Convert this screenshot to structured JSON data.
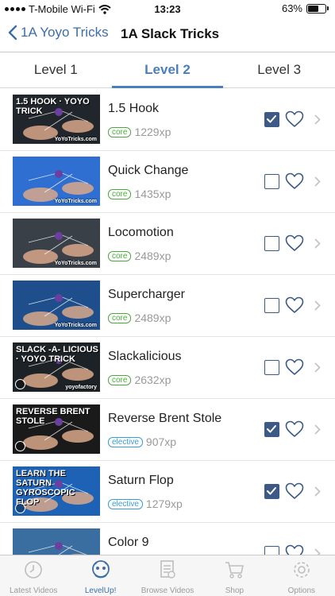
{
  "status_bar": {
    "carrier": "T-Mobile Wi-Fi",
    "time": "13:23",
    "battery": "63%",
    "battery_level": 0.63
  },
  "nav": {
    "back_label": "1A Yoyo Tricks",
    "title": "1A Slack Tricks"
  },
  "tabs": [
    {
      "label": "Level 1",
      "active": false
    },
    {
      "label": "Level 2",
      "active": true
    },
    {
      "label": "Level 3",
      "active": false
    }
  ],
  "tricks": [
    {
      "title": "1.5 Hook",
      "category": "core",
      "xp": "1229xp",
      "completed": true,
      "thumb_text": "1.5 HOOK · YOYO TRICK",
      "thumb_logo": "YoYoTricks.com",
      "thumb_bg": "#20262c"
    },
    {
      "title": "Quick Change",
      "category": "core",
      "xp": "1435xp",
      "completed": false,
      "thumb_text": "",
      "thumb_logo": "YoYoTricks.com",
      "thumb_bg": "#2f6fd2"
    },
    {
      "title": "Locomotion",
      "category": "core",
      "xp": "2489xp",
      "completed": false,
      "thumb_text": "",
      "thumb_logo": "YoYoTricks.com",
      "thumb_bg": "#3a4048"
    },
    {
      "title": "Supercharger",
      "category": "core",
      "xp": "2489xp",
      "completed": false,
      "thumb_text": "",
      "thumb_logo": "YoYoTricks.com",
      "thumb_bg": "#1e4f8c"
    },
    {
      "title": "Slackalicious",
      "category": "core",
      "xp": "2632xp",
      "completed": false,
      "thumb_text": "SLACK -A- LICIOUS · YOYO TRICK",
      "thumb_logo": "yoyofactory",
      "thumb_bg": "#1c2226"
    },
    {
      "title": "Reverse Brent Stole",
      "category": "elective",
      "xp": "907xp",
      "completed": true,
      "thumb_text": "REVERSE BRENT STOLE",
      "thumb_logo": "",
      "thumb_bg": "#1a1a1a"
    },
    {
      "title": "Saturn Flop",
      "category": "elective",
      "xp": "1279xp",
      "completed": true,
      "thumb_text": "LEARN THE SATURN GYROSCOPIC FLOP",
      "thumb_logo": "",
      "thumb_bg": "#1e62b5"
    },
    {
      "title": "Color 9",
      "category": "",
      "xp": "",
      "completed": false,
      "thumb_text": "",
      "thumb_logo": "",
      "thumb_bg": "#3a6ea0"
    }
  ],
  "tab_bar": [
    {
      "label": "Latest Videos",
      "icon": "clock-icon",
      "active": false
    },
    {
      "label": "LevelUp!",
      "icon": "levelup-icon",
      "active": true
    },
    {
      "label": "Browse Videos",
      "icon": "document-icon",
      "active": false
    },
    {
      "label": "Shop",
      "icon": "cart-icon",
      "active": false
    },
    {
      "label": "Options",
      "icon": "gear-icon",
      "active": false
    }
  ],
  "colors": {
    "accent": "#3c6ea8",
    "tab_active": "#4a7fbd",
    "checkbox": "#3c5a85",
    "core": "#4caa3c",
    "elective": "#3a9bd8"
  }
}
